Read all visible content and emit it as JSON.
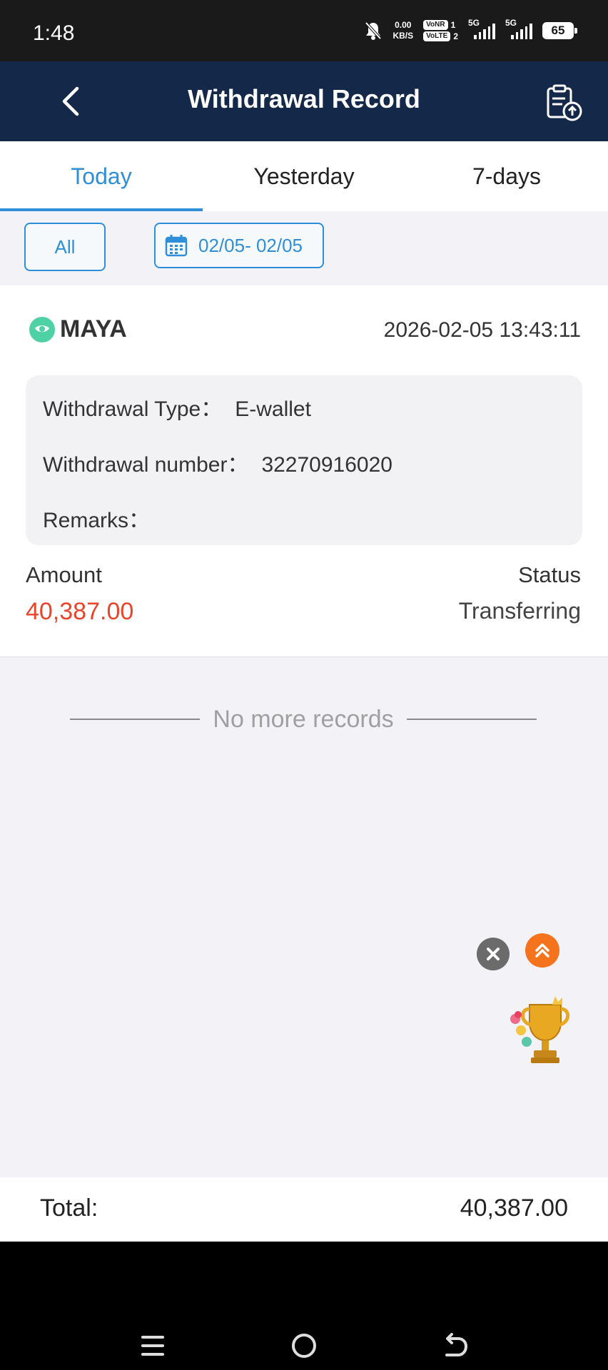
{
  "status_bar": {
    "time": "1:48",
    "net_speed_top": "0.00",
    "net_speed_bottom": "KB/S",
    "vonr": "VoNR",
    "volte": "VoLTE",
    "sim1": "1",
    "sim2": "2",
    "network1": "5G",
    "network2": "5G",
    "battery": "65"
  },
  "header": {
    "title": "Withdrawal Record"
  },
  "tabs": [
    {
      "label": "Today",
      "active": true
    },
    {
      "label": "Yesterday",
      "active": false
    },
    {
      "label": "7-days",
      "active": false
    }
  ],
  "filters": {
    "all_label": "All",
    "date_range": "02/05- 02/05"
  },
  "record": {
    "brand": "MAYA",
    "datetime": "2026-02-05 13:43:11",
    "type_label": "Withdrawal Type：",
    "type_value": "E-wallet",
    "number_label": "Withdrawal number：",
    "number_value": "32270916020",
    "remarks_label": "Remarks：",
    "remarks_value": "",
    "amount_label": "Amount",
    "amount_value": "40,387.00",
    "status_label": "Status",
    "status_value": "Transferring"
  },
  "list_end_text": "No more records",
  "total": {
    "label": "Total:",
    "value": "40,387.00"
  },
  "colors": {
    "header_bg": "#14284a",
    "accent": "#2e8fd8",
    "amount": "#e8452a",
    "scroll_top_button": "#f5731c"
  },
  "icons": [
    "back-arrow-icon",
    "clipboard-upload-icon",
    "calendar-icon",
    "maya-logo-icon",
    "close-icon",
    "chevron-double-up-icon",
    "trophy-icon",
    "menu-icon",
    "home-icon",
    "back-nav-icon"
  ]
}
